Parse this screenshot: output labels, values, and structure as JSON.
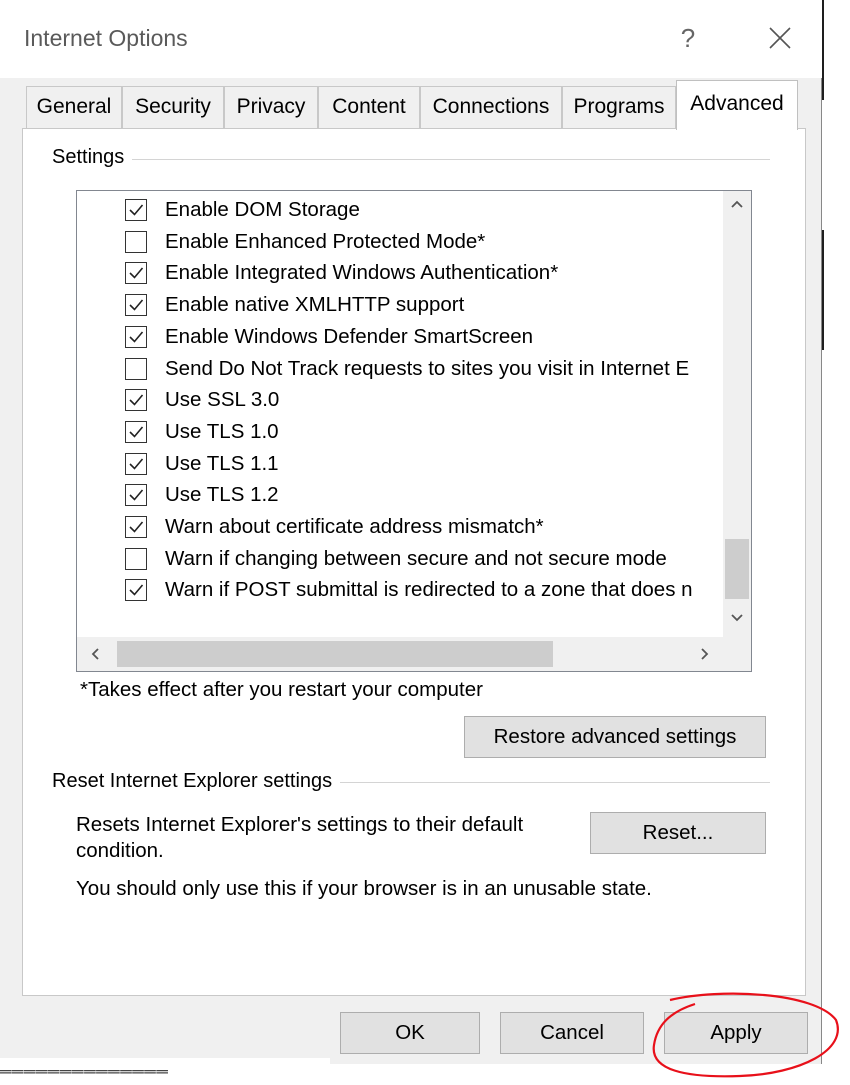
{
  "window": {
    "title": "Internet Options",
    "help_icon": "?"
  },
  "tabs": [
    "General",
    "Security",
    "Privacy",
    "Content",
    "Connections",
    "Programs",
    "Advanced"
  ],
  "active_tab": "Advanced",
  "settings": {
    "group_label": "Settings",
    "items": [
      {
        "label": "Enable DOM Storage",
        "checked": true
      },
      {
        "label": "Enable Enhanced Protected Mode*",
        "checked": false
      },
      {
        "label": "Enable Integrated Windows Authentication*",
        "checked": true
      },
      {
        "label": "Enable native XMLHTTP support",
        "checked": true
      },
      {
        "label": "Enable Windows Defender SmartScreen",
        "checked": true
      },
      {
        "label": "Send Do Not Track requests to sites you visit in Internet E",
        "checked": false
      },
      {
        "label": "Use SSL 3.0",
        "checked": true
      },
      {
        "label": "Use TLS 1.0",
        "checked": true
      },
      {
        "label": "Use TLS 1.1",
        "checked": true
      },
      {
        "label": "Use TLS 1.2",
        "checked": true
      },
      {
        "label": "Warn about certificate address mismatch*",
        "checked": true
      },
      {
        "label": "Warn if changing between secure and not secure mode",
        "checked": false
      },
      {
        "label": "Warn if POST submittal is redirected to a zone that does n",
        "checked": true
      }
    ],
    "note": "*Takes effect after you restart your computer",
    "restore_button": "Restore advanced settings"
  },
  "reset": {
    "group_label": "Reset Internet Explorer settings",
    "description_line1": "Resets Internet Explorer's settings to their default",
    "description_line2": "condition.",
    "button": "Reset...",
    "warning": "You should only use this if your browser is in an unusable state."
  },
  "footer": {
    "ok": "OK",
    "cancel": "Cancel",
    "apply": "Apply"
  },
  "colors": {
    "annotation_circle": "#e8101a",
    "checkbox_border": "#333333",
    "button_face": "#e1e1e1"
  }
}
